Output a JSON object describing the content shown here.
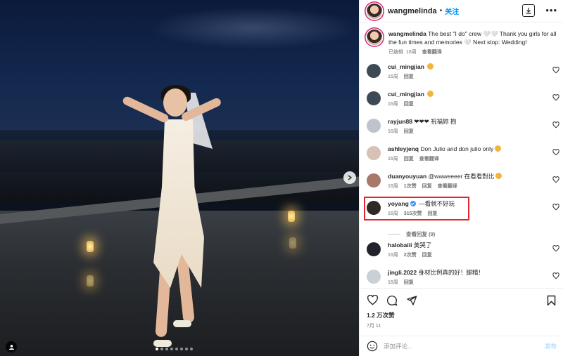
{
  "post": {
    "image_dots": 8,
    "active_dot": 0
  },
  "header": {
    "username": "wangmelinda",
    "separator": "•",
    "follow_label": "关注",
    "download_icon": "download-icon",
    "more_label": "•••"
  },
  "caption": {
    "username": "wangmelinda",
    "text": "The best \"I do\" crew 🤍🤍 Thank you girls for all the fun times and memories 🤍 Next stop: Wedding!",
    "edited_label": "已编辑",
    "separator": "·",
    "time": "16周",
    "translate_label": "查看翻译"
  },
  "comments": [
    {
      "username": "cui_mingjian",
      "text": "",
      "emoji_color": "#f3b43b",
      "time": "16周",
      "likes": "",
      "reply": "回复",
      "translate": "",
      "avatar_color": "#3d4a55"
    },
    {
      "username": "cui_mingjian",
      "text": "",
      "emoji_color": "#f3b43b",
      "time": "16周",
      "likes": "",
      "reply": "回复",
      "translate": "",
      "avatar_color": "#3d4a55"
    },
    {
      "username": "rayjun88",
      "text": "❤❤❤ 祝福妳 抱",
      "emoji_color": "",
      "time": "16周",
      "likes": "",
      "reply": "回复",
      "translate": "",
      "avatar_color": "#bfc4cc"
    },
    {
      "username": "ashleyjenq",
      "text": "Don Julio and don julio only",
      "emoji_color": "#f3b43b",
      "time": "16周",
      "likes": "",
      "reply": "回复",
      "translate": "查看翻译",
      "avatar_color": "#d7c2b6"
    },
    {
      "username": "duanyouyuan",
      "text": "@wwweeeer 在看看對比",
      "emoji_color": "#f3b43b",
      "time": "16周",
      "likes": "1次赞",
      "reply": "回复",
      "translate": "查看翻译",
      "avatar_color": "#a8786a"
    },
    {
      "username": "yoyang",
      "text": "—看就不好玩",
      "emoji_color": "",
      "time": "16周",
      "likes": "315次赞",
      "reply": "回复",
      "translate": "",
      "avatar_color": "#2f2a26",
      "verified": true,
      "highlighted": true
    },
    {
      "username": "halobaiii",
      "text": "美哭了",
      "emoji_color": "",
      "time": "16周",
      "likes": "2次赞",
      "reply": "回复",
      "translate": "",
      "avatar_color": "#20242a"
    },
    {
      "username": "jingli.2022",
      "text": "身材比例真的好！腿精！",
      "emoji_color": "",
      "time": "16周",
      "likes": "",
      "reply": "回复",
      "translate": "",
      "avatar_color": "#c9d0d6"
    }
  ],
  "view_replies_label": "查看回复 (9)",
  "likes": "1.2 万次赞",
  "date": "7月 11",
  "add_comment": {
    "placeholder": "添加评论...",
    "post_label": "发布"
  },
  "colors": {
    "accent": "#0095f6",
    "highlight_border": "#e0262a"
  }
}
